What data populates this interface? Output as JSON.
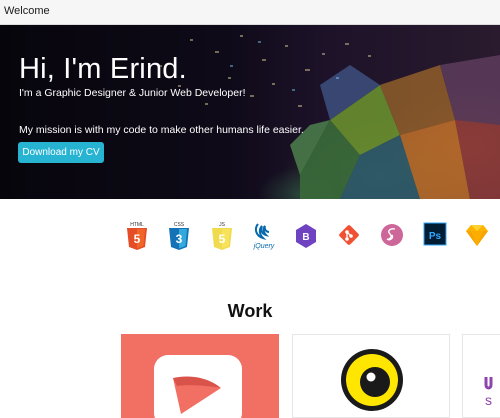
{
  "window": {
    "title": "Welcome"
  },
  "hero": {
    "headline": "Hi, I'm Erind.",
    "subtitle": "I'm a Graphic Designer & Junior Web Developer!",
    "mission": "My mission is with my code to make other humans life easier.",
    "cv_button": "Download my CV"
  },
  "skills": {
    "icons": [
      {
        "name": "html5-icon",
        "caption": "HTML",
        "color": "#e44d26"
      },
      {
        "name": "css3-icon",
        "caption": "CSS",
        "color": "#1572b6"
      },
      {
        "name": "js-icon",
        "caption": "JS",
        "color": "#f0db4f"
      },
      {
        "name": "jquery-icon",
        "caption": "jQuery",
        "color": "#0769ad"
      },
      {
        "name": "bootstrap-icon",
        "color": "#6f42c1"
      },
      {
        "name": "git-icon",
        "color": "#f05033"
      },
      {
        "name": "sass-icon",
        "color": "#cd6799"
      },
      {
        "name": "photoshop-icon",
        "caption": "Ps",
        "color": "#31a8ff"
      },
      {
        "name": "sketch-icon",
        "color": "#fdb300"
      }
    ]
  },
  "work": {
    "title": "Work",
    "cards": [
      {
        "name": "work-card-1",
        "bg": "#f26f64"
      },
      {
        "name": "work-card-2",
        "bg": "#ffffff"
      },
      {
        "name": "work-card-3",
        "bg": "#ffffff"
      }
    ]
  }
}
